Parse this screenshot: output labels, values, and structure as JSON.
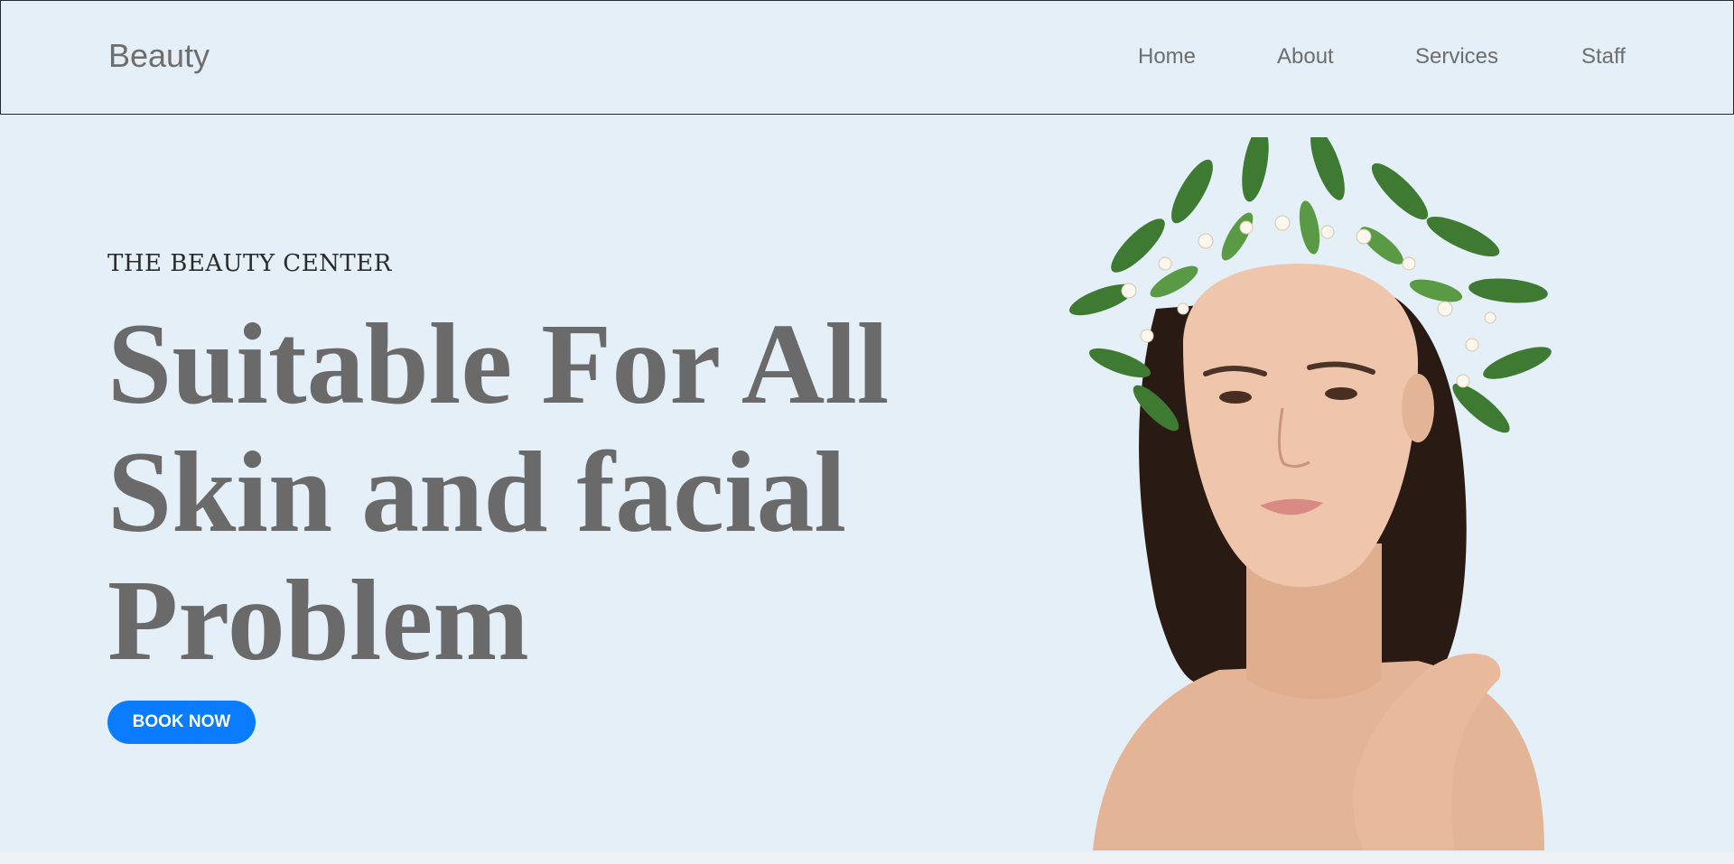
{
  "header": {
    "brand": "Beauty",
    "nav": [
      "Home",
      "About",
      "Services",
      "Staff"
    ]
  },
  "hero": {
    "eyebrow": "THE BEAUTY CENTER",
    "headline_lines": [
      "Suitable For All",
      "Skin and facial",
      "Problem"
    ],
    "cta_label": "BOOK NOW"
  },
  "colors": {
    "background": "#e4eff7",
    "accent": "#0a7cff",
    "heading_text": "#6a6a6a",
    "nav_text": "#6e6e6e"
  },
  "icons": {
    "hero_image": "woman-with-flower-crown-photo"
  }
}
